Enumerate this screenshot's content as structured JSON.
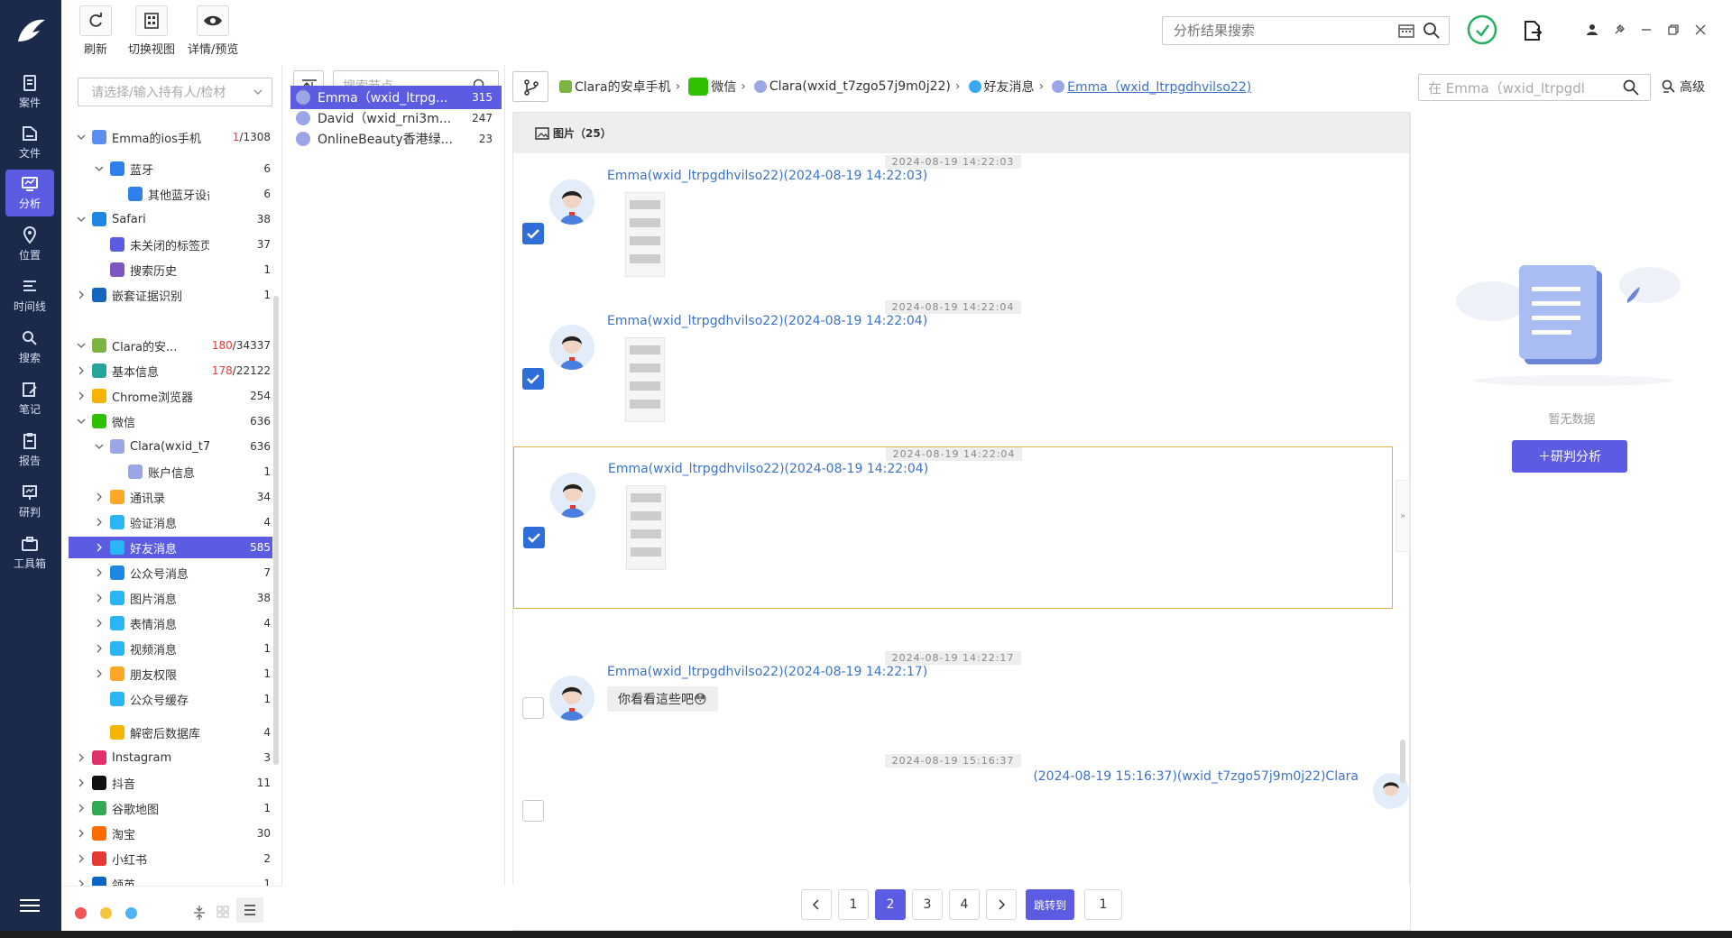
{
  "nav": {
    "items": [
      {
        "label": "案件",
        "icon": "case-icon"
      },
      {
        "label": "文件",
        "icon": "file-icon"
      },
      {
        "label": "分析",
        "icon": "analysis-icon",
        "active": true
      },
      {
        "label": "位置",
        "icon": "location-icon"
      },
      {
        "label": "时间线",
        "icon": "timeline-icon"
      },
      {
        "label": "搜索",
        "icon": "search-icon"
      },
      {
        "label": "笔记",
        "icon": "note-icon"
      },
      {
        "label": "报告",
        "icon": "report-icon"
      },
      {
        "label": "研判",
        "icon": "judge-icon"
      },
      {
        "label": "工具箱",
        "icon": "toolbox-icon"
      }
    ]
  },
  "toolbar": {
    "refresh": "刷新",
    "switch_view": "切换视图",
    "detail_preview": "详情/预览",
    "search_placeholder": "分析结果搜索"
  },
  "tree": {
    "owner_placeholder": "请选择/输入持有人/检材",
    "rows": [
      {
        "label": "Emma的ios手机",
        "count_red": "1",
        "count": "/1308"
      },
      {
        "label": "蓝牙",
        "count": "6"
      },
      {
        "label": "其他蓝牙设备",
        "count": "6"
      },
      {
        "label": "Safari",
        "count": "38"
      },
      {
        "label": "未关闭的标签页",
        "count": "37"
      },
      {
        "label": "搜索历史",
        "count": "1"
      },
      {
        "label": "嵌套证据识别",
        "count": "1"
      },
      {
        "label": "Clara的安...",
        "count_red": "180",
        "count": "/34337"
      },
      {
        "label": "基本信息",
        "count_red": "178",
        "count": "/22122"
      },
      {
        "label": "Chrome浏览器",
        "count": "254"
      },
      {
        "label": "微信",
        "count": "636"
      },
      {
        "label": "Clara(wxid_t7...",
        "count": "636"
      },
      {
        "label": "账户信息",
        "count": "1"
      },
      {
        "label": "通讯录",
        "count": "34"
      },
      {
        "label": "验证消息",
        "count": "4"
      },
      {
        "label": "好友消息",
        "count": "585"
      },
      {
        "label": "公众号消息",
        "count": "7"
      },
      {
        "label": "图片消息",
        "count": "38"
      },
      {
        "label": "表情消息",
        "count": "4"
      },
      {
        "label": "视频消息",
        "count": "1"
      },
      {
        "label": "朋友权限",
        "count": "1"
      },
      {
        "label": "公众号缓存",
        "count": "1"
      },
      {
        "label": "解密后数据库",
        "count": "4"
      },
      {
        "label": "Instagram",
        "count": "3"
      },
      {
        "label": "抖音",
        "count": "11"
      },
      {
        "label": "谷歌地图",
        "count": "1"
      },
      {
        "label": "淘宝",
        "count": "30"
      },
      {
        "label": "小红书",
        "count": "2"
      },
      {
        "label": "领英",
        "count": "1"
      }
    ]
  },
  "contacts": {
    "search_placeholder": "搜索节点",
    "items": [
      {
        "name": "Emma（wxid_ltrpg...",
        "count": "315"
      },
      {
        "name": "David（wxid_rni3m...",
        "count": "247"
      },
      {
        "name": "OnlineBeauty香港绿...",
        "count": "23"
      }
    ]
  },
  "breadcrumb": {
    "items": [
      "Clara的安卓手机",
      "微信",
      "Clara(wxid_t7zgo57j9m0j22)",
      "好友消息",
      "Emma（wxid_ltrpgdhvilso22)"
    ]
  },
  "chat": {
    "search_placeholder": "在 Emma（wxid_ltrpgdl",
    "advanced": "高级",
    "filter_label": "图片（25）",
    "messages": [
      {
        "time": "2024-08-19 14:22:03",
        "sender": "Emma(wxid_ltrpgdhvilso22)(2024-08-19 14:22:03)"
      },
      {
        "time": "2024-08-19 14:22:04",
        "sender": "Emma(wxid_ltrpgdhvilso22)(2024-08-19 14:22:04)"
      },
      {
        "time": "2024-08-19 14:22:04",
        "sender": "Emma(wxid_ltrpgdhvilso22)(2024-08-19 14:22:04)"
      },
      {
        "time": "2024-08-19 14:22:17",
        "sender": "Emma(wxid_ltrpgdhvilso22)(2024-08-19 14:22:17)",
        "text": "你看看這些吧😳"
      },
      {
        "time": "2024-08-19 15:16:37",
        "sender": "(2024-08-19 15:16:37)(wxid_t7zgo57j9m0j22)Clara"
      }
    ],
    "pager": {
      "pages": [
        "1",
        "2",
        "3",
        "4"
      ],
      "current": "2",
      "jump": "跳转到",
      "jump_value": "1"
    }
  },
  "right": {
    "empty": "暂无数据",
    "button": "＋研判分析"
  },
  "colors": {
    "accent": "#5b5ce2",
    "nav_bg": "#1b2a4a",
    "link": "#3b73c9",
    "highlight_border": "#d9b24b"
  }
}
